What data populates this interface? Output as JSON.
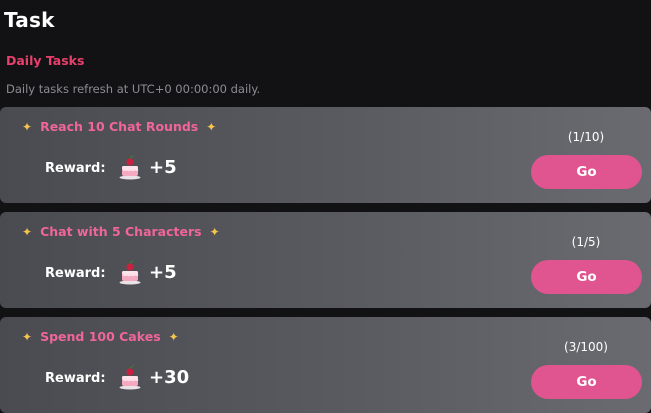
{
  "page": {
    "title": "Task"
  },
  "section": {
    "title": "Daily Tasks",
    "note": "Daily tasks refresh at UTC+0 00:00:00 daily."
  },
  "tasks": [
    {
      "name": "Reach 10 Chat Rounds",
      "reward_label": "Reward:",
      "reward": "+5",
      "progress": "(1/10)",
      "button": "Go"
    },
    {
      "name": "Chat with 5 Characters",
      "reward_label": "Reward:",
      "reward": "+5",
      "progress": "(1/5)",
      "button": "Go"
    },
    {
      "name": "Spend 100 Cakes",
      "reward_label": "Reward:",
      "reward": "+30",
      "progress": "(3/100)",
      "button": "Go"
    }
  ],
  "icons": {
    "sparkle": "sparkle-icon",
    "reward": "cake-icon"
  },
  "colors": {
    "accent": "#e0548f",
    "task_name": "#f0659a",
    "section_title": "#e8406d",
    "sparkle": "#f6c54b"
  }
}
